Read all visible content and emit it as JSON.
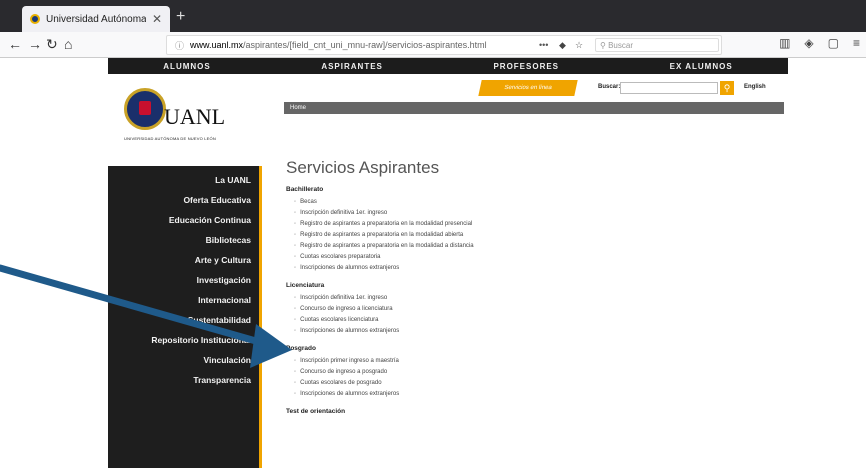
{
  "browser": {
    "tab_title": "Universidad Autónoma de Nue",
    "tab_close": "✕",
    "new_tab": "+",
    "url_host": "www.uanl.mx",
    "url_path": "/aspirantes/[field_cnt_uni_mnu-raw]/servicios-aspirantes.html",
    "search_placeholder": "Buscar"
  },
  "topnav": {
    "items": [
      "ALUMNOS",
      "ASPIRANTES",
      "PROFESORES",
      "EX ALUMNOS"
    ]
  },
  "searchrow": {
    "servicios_label": "Servicios en línea",
    "buscar_label": "Buscar:",
    "english_label": "English"
  },
  "logo": {
    "text": "UANL",
    "subtitle": "UNIVERSIDAD AUTÓNOMA DE NUEVO LEÓN"
  },
  "breadcrumb": "Home",
  "sidebar": {
    "items": [
      "La UANL",
      "Oferta Educativa",
      "Educación Continua",
      "Bibliotecas",
      "Arte y Cultura",
      "Investigación",
      "Internacional",
      "Sustentabilidad",
      "Repositorio Institucional",
      "Vinculación",
      "Transparencia"
    ]
  },
  "content": {
    "title": "Servicios Aspirantes",
    "sections": [
      {
        "heading": "Bachillerato",
        "items": [
          "Becas",
          "Inscripción definitiva 1er. ingreso",
          "Registro de aspirantes a preparatoria en la modalidad presencial",
          "Registro de aspirantes a preparatoria en la modalidad abierta",
          "Registro de aspirantes a preparatoria en la modalidad a distancia",
          "Cuotas escolares preparatoria",
          "Inscripciones de alumnos extranjeros"
        ]
      },
      {
        "heading": "Licenciatura",
        "items": [
          "Inscripción definitiva 1er. ingreso",
          "Concurso de ingreso a licenciatura",
          "Cuotas escolares licenciatura",
          "Inscripciones de alumnos extranjeros"
        ]
      },
      {
        "heading": "Posgrado",
        "items": [
          "Inscripción primer ingreso a maestría",
          "Concurso de ingreso a posgrado",
          "Cuotas escolares de posgrado",
          "Inscripciones de alumnos extranjeros"
        ]
      },
      {
        "heading": "Test de orientación",
        "items": []
      }
    ]
  },
  "colors": {
    "accent": "#f0a400",
    "arrow": "#1f5a8a",
    "sidebar_bg": "#1e1e1e"
  }
}
